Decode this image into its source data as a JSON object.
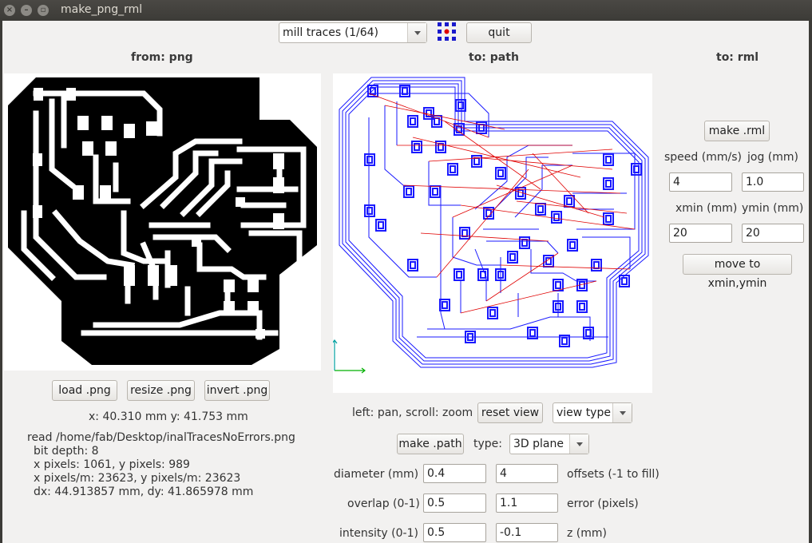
{
  "window": {
    "title": "make_png_rml"
  },
  "toolbar": {
    "process_value": "mill traces (1/64)",
    "quit_label": "quit"
  },
  "columns": {
    "from_label": "from: png",
    "to_path_label": "to: path",
    "to_rml_label": "to: rml"
  },
  "png_panel": {
    "load_label": "load .png",
    "resize_label": "resize .png",
    "invert_label": "invert .png",
    "coords": "x: 40.310 mm  y: 41.753 mm",
    "info": {
      "read": "read /home/fab/Desktop/inalTracesNoErrors.png",
      "bit_depth": "bit depth: 8",
      "pixels": "x pixels: 1061, y pixels: 989",
      "pixels_per_m": "x pixels/m: 23623, y pixels/m: 23623",
      "dims": "dx: 44.913857 mm, dy: 41.865978 mm"
    }
  },
  "path_panel": {
    "hint": "left: pan, scroll: zoom",
    "reset_view_label": "reset view",
    "view_type_value": "view type",
    "make_path_label": "make .path",
    "type_label": "type:",
    "type_value": "3D plane",
    "diameter_label": "diameter (mm)",
    "diameter_value": "0.4",
    "offsets_value": "4",
    "offsets_label": "offsets (-1 to fill)",
    "overlap_label": "overlap (0-1)",
    "overlap_value": "0.5",
    "error_value": "1.1",
    "error_label": "error (pixels)",
    "intensity_label": "intensity (0-1)",
    "intensity_value": "0.5",
    "z_value": "-0.1",
    "z_label": "z (mm)"
  },
  "rml_panel": {
    "make_rml_label": "make .rml",
    "speed_label": "speed (mm/s)",
    "jog_label": "jog (mm)",
    "speed_value": "4",
    "jog_value": "1.0",
    "xmin_label": "xmin (mm)",
    "ymin_label": "ymin (mm)",
    "xmin_value": "20",
    "ymin_value": "20",
    "move_label": "move to xmin,ymin"
  },
  "colors": {
    "trace_path": "#1a1aff",
    "move_path": "#e00000",
    "axis_x": "#00b000",
    "axis_y": "#00a0a0"
  }
}
